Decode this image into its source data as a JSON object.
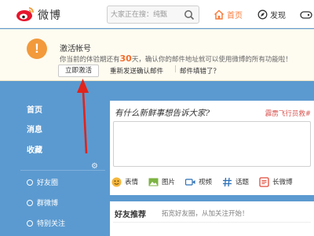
{
  "header": {
    "logo_text": "微博",
    "search_placeholder": "大家正在搜：纯甄",
    "nav": [
      {
        "label": "首页"
      },
      {
        "label": "发现"
      }
    ]
  },
  "notice": {
    "title": "激活帐号",
    "desc_prefix": "你当前的体验期还有",
    "days": "30",
    "desc_suffix": "天，确认你的邮件地址就可以使用微博的所有功能啦！",
    "activate_label": "立即激活",
    "resend_label": "重新发送确认邮件",
    "separator": "|",
    "wrong_email_label": "邮件填错了？"
  },
  "sidebar": {
    "items": [
      {
        "label": "首页"
      },
      {
        "label": "消息"
      },
      {
        "label": "收藏"
      }
    ],
    "groups": [
      {
        "label": "好友圈"
      },
      {
        "label": "群微博"
      },
      {
        "label": "特别关注"
      }
    ]
  },
  "publish": {
    "prompt": "有什么新鲜事想告诉大家?",
    "hot_topic": "霹雳飞行员救#",
    "tools": [
      {
        "label": "表情"
      },
      {
        "label": "图片"
      },
      {
        "label": "视频"
      },
      {
        "label": "话题"
      },
      {
        "label": "长微博"
      }
    ]
  },
  "friends": {
    "title": "好友推荐",
    "subtitle": "拓宽好友圈，从加关注开始！"
  },
  "colors": {
    "accent": "#fa7d3c",
    "background": "#5b9ad0",
    "notice_bg": "#fefbf0",
    "warn": "#f29a3c",
    "arrow": "#e0231c"
  }
}
